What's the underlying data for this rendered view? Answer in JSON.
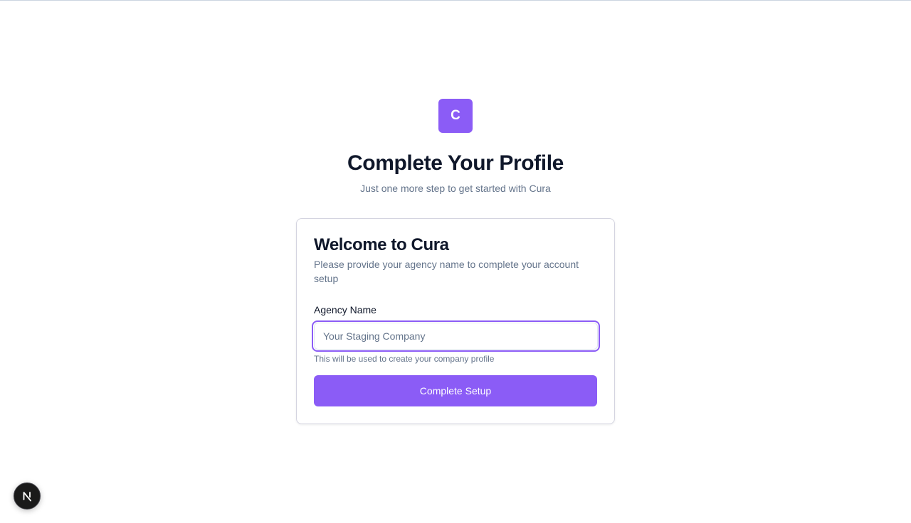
{
  "brand": {
    "logo_letter": "C",
    "accent_color": "#8b5cf6"
  },
  "header": {
    "title": "Complete Your Profile",
    "subtitle": "Just one more step to get started with Cura"
  },
  "card": {
    "title": "Welcome to Cura",
    "description": "Please provide your agency name to complete your account setup",
    "field": {
      "label": "Agency Name",
      "placeholder": "Your Staging Company",
      "value": "",
      "hint": "This will be used to create your company profile"
    },
    "submit_label": "Complete Setup"
  },
  "dev_indicator": {
    "icon": "nextjs-logo-icon"
  }
}
